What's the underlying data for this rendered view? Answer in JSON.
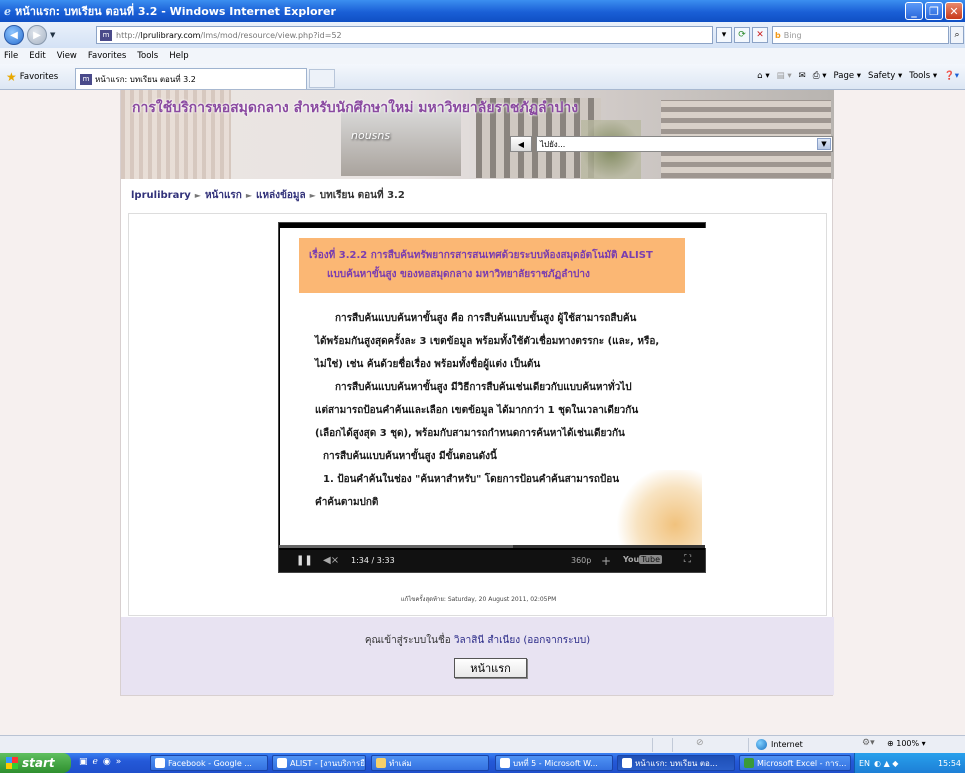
{
  "window": {
    "title": "หน้าแรก: บทเรียน ตอนที่ 3.2 - Windows Internet Explorer"
  },
  "addressbar": {
    "url_prefix": "http://",
    "url_domain": "lprulibrary.com",
    "url_path": "/lms/mod/resource/view.php?id=52",
    "search_placeholder": "Bing"
  },
  "menubar": {
    "items": [
      "File",
      "Edit",
      "View",
      "Favorites",
      "Tools",
      "Help"
    ]
  },
  "favbar": {
    "favorites_label": "Favorites",
    "tab_title": "หน้าแรก: บทเรียน ตอนที่ 3.2",
    "cmd_page": "Page",
    "cmd_safety": "Safety",
    "cmd_tools": "Tools"
  },
  "site": {
    "banner_title": "การใช้บริการหอสมุดกลาง สำหรับนักศึกษาใหม่ มหาวิทยาลัยราชภัฏลำปาง",
    "banner_sign": "nousns",
    "jump_label": "ไปยัง...",
    "breadcrumb": [
      "lprulibrary",
      "หน้าแรก",
      "แหล่งข้อมูล",
      "บทเรียน ตอนที่ 3.2"
    ],
    "breadcrumb_sep": "►"
  },
  "video": {
    "slide_header_line1": "เรื่องที่ 3.2.2  การสืบค้นทรัพยากรสารสนเทศด้วยระบบห้องสมุดอัตโนมัติ ALIST",
    "slide_header_line2": "แบบค้นหาขั้นสูง ของหอสมุดกลาง มหาวิทยาลัยราชภัฏลำปาง",
    "slide_lines": [
      "การสืบค้นแบบค้นหาขั้นสูง คือ การสืบค้นแบบขั้นสูง ผู้ใช้สามารถสืบค้น",
      "ได้พร้อมกันสูงสุดครั้งละ 3 เขตข้อมูล พร้อมทั้งใช้ตัวเชื่อมทางตรรกะ (และ, หรือ,",
      "ไม่ใช่) เช่น ค้นด้วยชื่อเรื่อง พร้อมทั้งชื่อผู้แต่ง เป็นต้น",
      "การสืบค้นแบบค้นหาขั้นสูง มีวิธีการสืบค้นเช่นเดียวกับแบบค้นหาทั่วไป",
      "แต่สามารถป้อนคำค้นและเลือก เขตข้อมูล ได้มากกว่า 1 ชุดในเวลาเดียวกัน",
      "(เลือกได้สูงสุด 3 ชุด), พร้อมกับสามารถกำหนดการค้นหาได้เช่นเดียวกัน",
      "การสืบค้นแบบค้นหาขั้นสูง มีขั้นตอนดังนี้",
      "1.  ป้อนคำค้นในช่อง \"ค้นหาสำหรับ\" โดยการป้อนคำค้นสามารถป้อน",
      "คำค้นตามปกติ"
    ],
    "time": "1:34 / 3:33",
    "progress": 0.44,
    "buffered": 0.55,
    "quality": "360p",
    "youtube": "You",
    "youtube_tube": "Tube"
  },
  "page": {
    "modified": "แก้ไขครั้งสุดท้าย: Saturday, 20 August 2011, 02:05PM",
    "login_prefix": "คุณเข้าสู่ระบบในชื่อ",
    "login_user": "วิลาสินี สำเนียง",
    "logout": "(ออกจากระบบ)",
    "home_button": "หน้าแรก"
  },
  "statusbar": {
    "zone": "Internet",
    "zoom": "100%"
  },
  "taskbar": {
    "start": "start",
    "buttons": [
      {
        "label": "Facebook - Google ..."
      },
      {
        "label": "ALIST - [งานบริการยื..."
      },
      {
        "label": "ทำเล่ม"
      },
      {
        "label": "บทที่ 5 - Microsoft W..."
      },
      {
        "label": "หน้าแรก: บทเรียน ตอ..."
      },
      {
        "label": "Microsoft Excel - การ..."
      }
    ],
    "lang": "EN",
    "clock": "15:54"
  },
  "colors": {
    "banner_title": "#8a4aa0",
    "slide_header_bg": "#fbb774",
    "footer_bg": "#e8e3f2",
    "page_bg": "#f6f0ef"
  }
}
